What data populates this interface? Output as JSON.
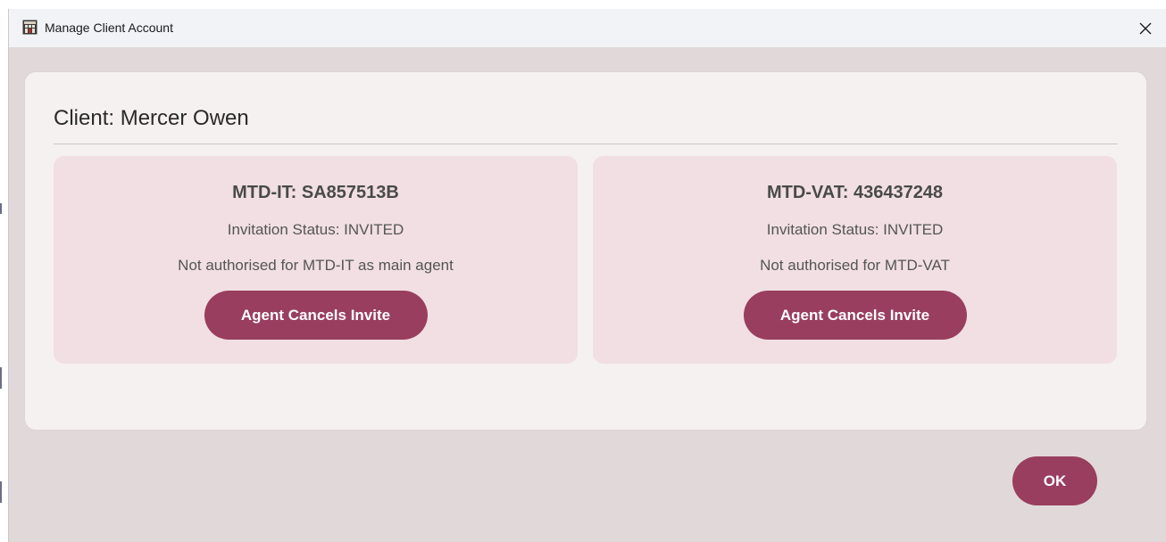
{
  "window": {
    "title": "Manage Client Account",
    "app_icon": "building-icon",
    "close_icon": "close-icon"
  },
  "client": {
    "title": "Client: Mercer Owen"
  },
  "panels": [
    {
      "heading": "MTD-IT: SA857513B",
      "status": "Invitation Status: INVITED",
      "authorisation": "Not authorised for MTD-IT as main agent",
      "button_label": "Agent Cancels Invite"
    },
    {
      "heading": "MTD-VAT: 436437248",
      "status": "Invitation Status: INVITED",
      "authorisation": "Not authorised for MTD-VAT",
      "button_label": "Agent Cancels Invite"
    }
  ],
  "footer": {
    "ok_label": "OK"
  },
  "colors": {
    "accent": "#993e5e",
    "panel_bg": "#f1dfe3",
    "window_bg": "#e1d9d9",
    "card_bg": "#f5f1f0"
  }
}
